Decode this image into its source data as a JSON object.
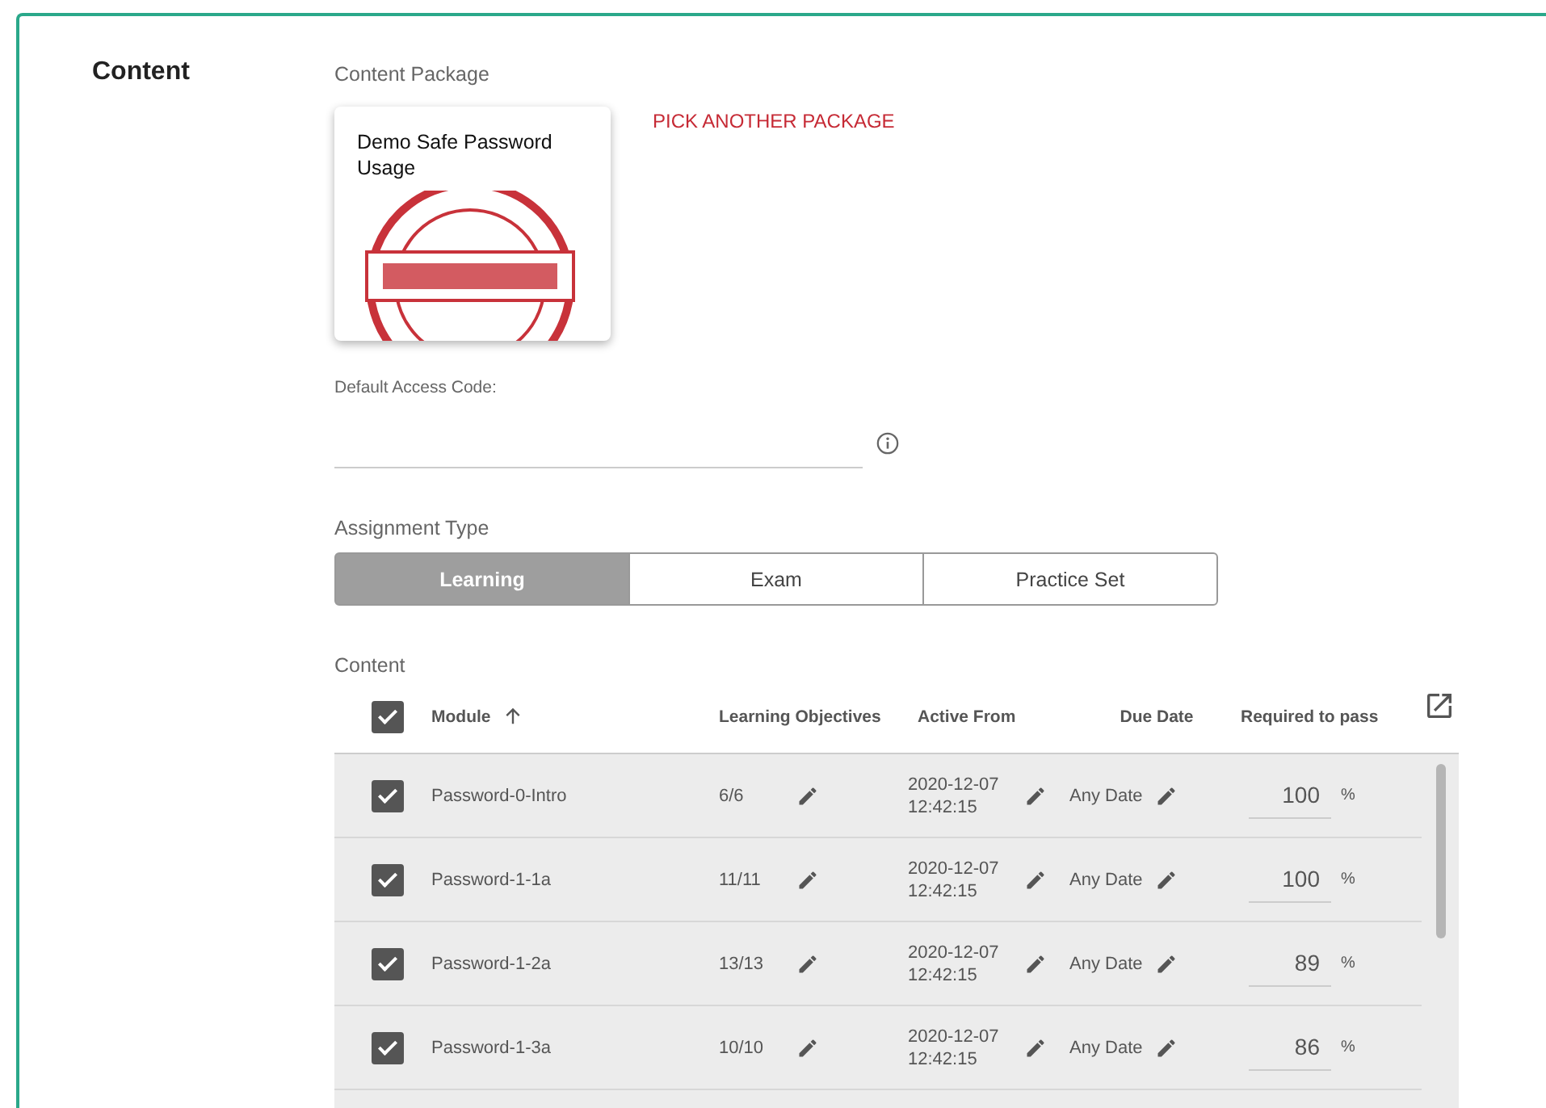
{
  "section": {
    "title": "Content"
  },
  "content_package": {
    "label": "Content Package",
    "card_title": "Demo Safe Password Usage",
    "pick_link": "PICK ANOTHER PACKAGE"
  },
  "access_code": {
    "label": "Default Access Code:"
  },
  "assignment_type": {
    "label": "Assignment Type",
    "options": [
      {
        "label": "Learning",
        "selected": true
      },
      {
        "label": "Exam",
        "selected": false
      },
      {
        "label": "Practice Set",
        "selected": false
      }
    ]
  },
  "content_table": {
    "label": "Content",
    "all_checked": true,
    "columns": [
      "Module",
      "Learning Objectives",
      "Active From",
      "Due Date",
      "Required to pass"
    ],
    "rows": [
      {
        "checked": true,
        "module": "Password-0-Intro",
        "objectives": "6/6",
        "active_from": [
          "2020-12-07",
          "12:42:15"
        ],
        "due_date": "Any Date",
        "required": "100",
        "unit": "%"
      },
      {
        "checked": true,
        "module": "Password-1-1a",
        "objectives": "11/11",
        "active_from": [
          "2020-12-07",
          "12:42:15"
        ],
        "due_date": "Any Date",
        "required": "100",
        "unit": "%"
      },
      {
        "checked": true,
        "module": "Password-1-2a",
        "objectives": "13/13",
        "active_from": [
          "2020-12-07",
          "12:42:15"
        ],
        "due_date": "Any Date",
        "required": "89",
        "unit": "%"
      },
      {
        "checked": true,
        "module": "Password-1-3a",
        "objectives": "10/10",
        "active_from": [
          "2020-12-07",
          "12:42:15"
        ],
        "due_date": "Any Date",
        "required": "86",
        "unit": "%"
      }
    ]
  }
}
